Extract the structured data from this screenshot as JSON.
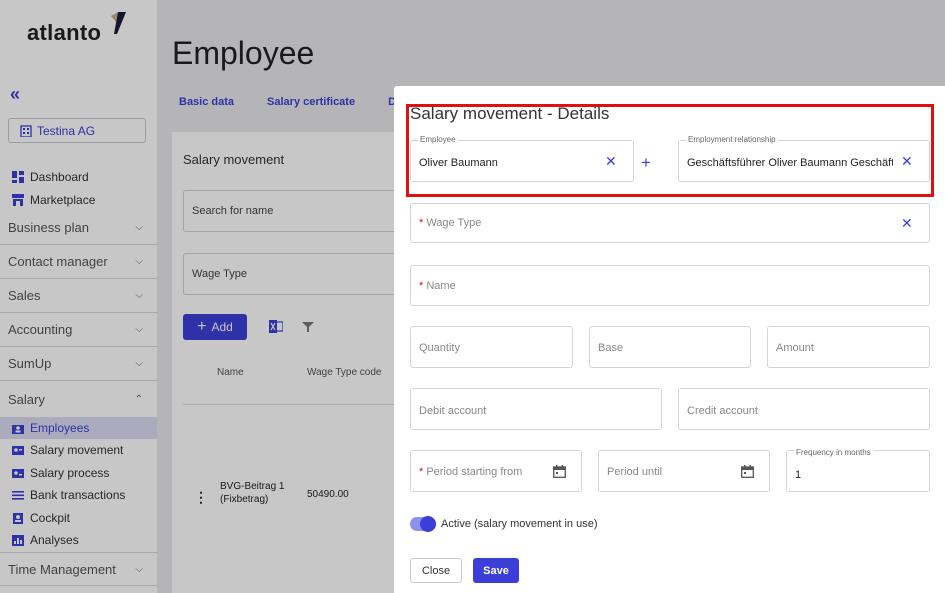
{
  "app": {
    "logo": "atlanto"
  },
  "sidebar": {
    "company": "Testina AG",
    "top_items": [
      {
        "label": "Dashboard",
        "icon": "dashboard-icon"
      },
      {
        "label": "Marketplace",
        "icon": "marketplace-icon"
      }
    ],
    "sections": [
      {
        "label": "Business plan"
      },
      {
        "label": "Contact manager"
      },
      {
        "label": "Sales"
      },
      {
        "label": "Accounting"
      },
      {
        "label": "SumUp"
      },
      {
        "label": "Salary"
      }
    ],
    "salary_items": [
      {
        "label": "Employees",
        "icon": "employees-icon",
        "active": true
      },
      {
        "label": "Salary movement",
        "icon": "salary-movement-icon"
      },
      {
        "label": "Salary process",
        "icon": "salary-process-icon"
      },
      {
        "label": "Bank transactions",
        "icon": "bank-transactions-icon"
      },
      {
        "label": "Cockpit",
        "icon": "cockpit-icon"
      },
      {
        "label": "Analyses",
        "icon": "analyses-icon"
      }
    ],
    "last_section": "Time Management"
  },
  "main": {
    "title": "Employee",
    "tabs": [
      "Basic data",
      "Salary certificate",
      "D"
    ],
    "card": {
      "title": "Salary movement",
      "search_placeholder": "Search for name",
      "wage_type_filter": "Wage Type",
      "add_label": "Add",
      "columns": [
        "Name",
        "Wage Type code"
      ],
      "rows": [
        {
          "name_line1": "BVG-Beitrag 1",
          "name_line2": "(Fixbetrag)",
          "code": "50490.00"
        }
      ]
    }
  },
  "dialog": {
    "title": "Salary movement - Details",
    "employee": {
      "label": "Employee",
      "value": "Oliver Baumann"
    },
    "employment": {
      "label": "Employment relationship",
      "value": "Geschäftsführer Oliver Baumann Geschäftsführer"
    },
    "wage_type": {
      "label": "Wage Type"
    },
    "name": {
      "label": "Name"
    },
    "quantity": {
      "placeholder": "Quantity"
    },
    "base": {
      "placeholder": "Base"
    },
    "amount": {
      "placeholder": "Amount"
    },
    "debit_account": {
      "placeholder": "Debit account"
    },
    "credit_account": {
      "placeholder": "Credit account"
    },
    "period_start": {
      "label": "Period starting from"
    },
    "period_until": {
      "placeholder": "Period until"
    },
    "frequency": {
      "label": "Frequency in months",
      "value": "1"
    },
    "active": {
      "label": "Active (salary movement in use)",
      "on": true
    },
    "close_label": "Close",
    "save_label": "Save"
  },
  "colors": {
    "accent": "#3b3fd8",
    "highlight": "#e01010"
  }
}
